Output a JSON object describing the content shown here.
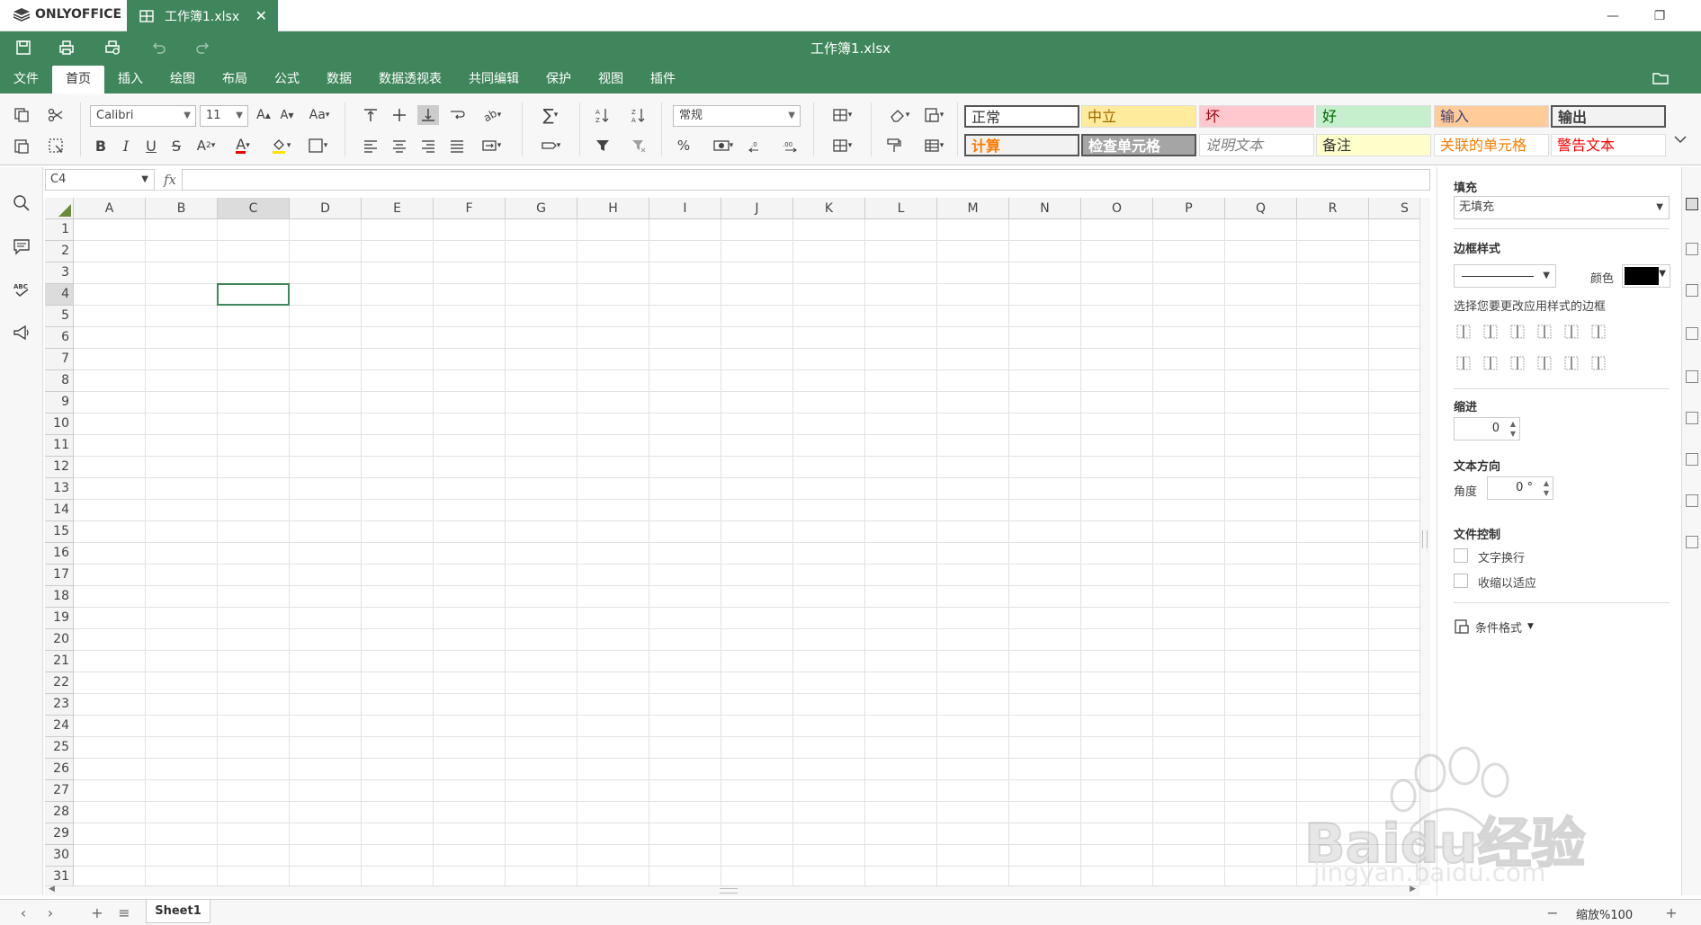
{
  "app": {
    "brand": "ONLYOFFICE",
    "tab_title": "工作簿1.xlsx",
    "doc_title": "工作簿1.xlsx",
    "accent": "#40865c"
  },
  "menu": {
    "items": [
      "文件",
      "首页",
      "插入",
      "绘图",
      "布局",
      "公式",
      "数据",
      "数据透视表",
      "共同编辑",
      "保护",
      "视图",
      "插件"
    ],
    "active": "首页"
  },
  "toolbar": {
    "font_name": "Calibri",
    "font_size": "11",
    "number_format": "常规",
    "styles": [
      {
        "label": "正常",
        "bg": "#ffffff",
        "color": "#333333"
      },
      {
        "label": "中立",
        "bg": "#ffeb9c",
        "color": "#9c6500"
      },
      {
        "label": "坏",
        "bg": "#ffc7ce",
        "color": "#9c0006"
      },
      {
        "label": "好",
        "bg": "#c6efce",
        "color": "#006100"
      },
      {
        "label": "输入",
        "bg": "#ffcc99",
        "color": "#3f3f76"
      },
      {
        "label": "输出",
        "bg": "#f2f2f2",
        "color": "#3f3f3f"
      },
      {
        "label": "计算",
        "bg": "#f2f2f2",
        "color": "#fa7d00"
      },
      {
        "label": "检查单元格",
        "bg": "#a5a5a5",
        "color": "#ffffff"
      },
      {
        "label": "说明文本",
        "bg": "#ffffff",
        "color": "#7f7f7f"
      },
      {
        "label": "备注",
        "bg": "#ffffcc",
        "color": "#333333"
      },
      {
        "label": "关联的单元格",
        "bg": "#ffffff",
        "color": "#fa7d00"
      },
      {
        "label": "警告文本",
        "bg": "#ffffff",
        "color": "#ff0000"
      }
    ]
  },
  "formula_bar": {
    "cell_ref": "C4",
    "fx": "fx",
    "value": ""
  },
  "sheet": {
    "columns": [
      "A",
      "B",
      "C",
      "D",
      "E",
      "F",
      "G",
      "H",
      "I",
      "J",
      "K",
      "L",
      "M",
      "N",
      "O",
      "P",
      "Q",
      "R",
      "S"
    ],
    "rows": [
      "1",
      "2",
      "3",
      "4",
      "5",
      "6",
      "7",
      "8",
      "9",
      "10",
      "11",
      "12",
      "13",
      "14",
      "15",
      "16",
      "17",
      "18",
      "19",
      "20",
      "21",
      "22",
      "23",
      "24",
      "25",
      "26",
      "27",
      "28",
      "29",
      "30",
      "31"
    ],
    "selected_col": "C",
    "selected_row": "4"
  },
  "right_panel": {
    "fill_label": "填充",
    "fill_value": "无填充",
    "border_style_label": "边框样式",
    "color_label": "颜色",
    "border_color": "#000000",
    "border_hint": "选择您要更改应用样式的边框",
    "indent_label": "缩进",
    "indent_value": "0",
    "text_dir_label": "文本方向",
    "angle_label": "角度",
    "angle_value": "0 °",
    "text_control_label": "文件控制",
    "wrap_label": "文字换行",
    "shrink_label": "收缩以适应",
    "cond_format_label": "条件格式"
  },
  "status": {
    "sheet_name": "Sheet1",
    "zoom": "缩放%100"
  },
  "watermark": {
    "line1": "Baidu经验",
    "line2": "jingyan.baidu.com"
  }
}
